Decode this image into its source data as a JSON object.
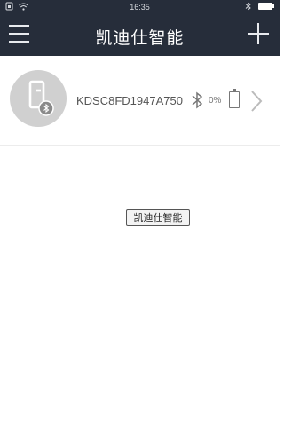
{
  "status_bar": {
    "time": "16:35",
    "left_icons": [
      "sim-icon",
      "wifi-icon"
    ],
    "right_icons": [
      "bluetooth-icon",
      "battery-icon"
    ]
  },
  "navbar": {
    "title": "凯迪仕智能",
    "menu_icon": "hamburger-menu-icon",
    "add_icon": "plus-icon"
  },
  "device": {
    "name": "KDSC8FD1947A750",
    "battery_percent": "0%",
    "battery_level": 0,
    "avatar_icon": "door-lock-bluetooth-icon",
    "connection_icon": "bluetooth-icon",
    "chevron_icon": "chevron-right-icon"
  },
  "center_button": {
    "label": "凯迪仕智能"
  },
  "colors": {
    "navbar_bg": "#262d3a",
    "avatar_bg": "#d0d0d0",
    "text_gray": "#555555"
  }
}
